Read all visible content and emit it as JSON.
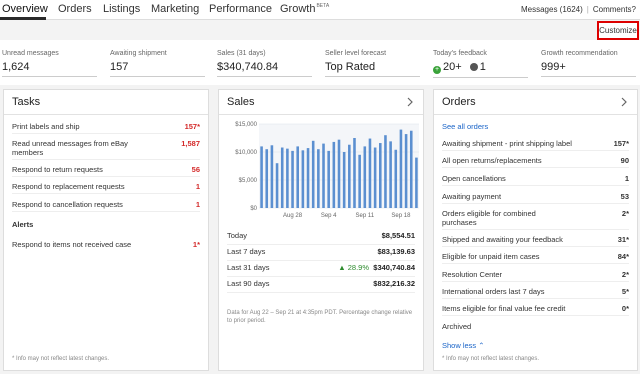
{
  "nav": {
    "tabs": [
      {
        "label": "Overview"
      },
      {
        "label": "Orders"
      },
      {
        "label": "Listings"
      },
      {
        "label": "Marketing"
      },
      {
        "label": "Performance"
      },
      {
        "label": "Growth",
        "badge": "BETA"
      }
    ],
    "messages": "Messages (1624)",
    "comments": "Comments?",
    "customize": "Customize"
  },
  "metrics": [
    {
      "label": "Unread messages",
      "value": "1,624"
    },
    {
      "label": "Awaiting shipment",
      "value": "157"
    },
    {
      "label": "Sales (31 days)",
      "value": "$340,740.84"
    },
    {
      "label": "Seller level forecast",
      "value": "Top Rated"
    },
    {
      "label": "Today's feedback",
      "positive": "20+",
      "neutral": "1"
    },
    {
      "label": "Growth recommendation",
      "value": "999+"
    }
  ],
  "tasks": {
    "title": "Tasks",
    "items": [
      {
        "label": "Print labels and ship",
        "value": "157*"
      },
      {
        "label": "Read unread messages from eBay members",
        "value": "1,587"
      },
      {
        "label": "Respond to return requests",
        "value": "56"
      },
      {
        "label": "Respond to replacement requests",
        "value": "1"
      },
      {
        "label": "Respond to cancellation requests",
        "value": "1"
      }
    ],
    "alerts_heading": "Alerts",
    "alerts": [
      {
        "label": "Respond to items not received case",
        "value": "1*"
      }
    ],
    "footnote": "* Info may not reflect latest changes."
  },
  "sales": {
    "title": "Sales",
    "rows": [
      {
        "label": "Today",
        "value": "$8,554.51"
      },
      {
        "label": "Last 7 days",
        "value": "$83,139.63"
      },
      {
        "label": "Last 31 days",
        "change": "▲ 28.9%",
        "value": "$340,740.84"
      },
      {
        "label": "Last 90 days",
        "value": "$832,216.32"
      }
    ],
    "note": "Data for Aug 22 – Sep 21 at 4:35pm PDT. Percentage change relative to prior period."
  },
  "chart_data": {
    "type": "bar",
    "categories": [
      "Aug 22",
      "Aug 23",
      "Aug 24",
      "Aug 25",
      "Aug 26",
      "Aug 27",
      "Aug 28",
      "Aug 29",
      "Aug 30",
      "Aug 31",
      "Sep 1",
      "Sep 2",
      "Sep 3",
      "Sep 4",
      "Sep 5",
      "Sep 6",
      "Sep 7",
      "Sep 8",
      "Sep 9",
      "Sep 10",
      "Sep 11",
      "Sep 12",
      "Sep 13",
      "Sep 14",
      "Sep 15",
      "Sep 16",
      "Sep 17",
      "Sep 18",
      "Sep 19",
      "Sep 20",
      "Sep 21"
    ],
    "values": [
      11000,
      10500,
      11200,
      8000,
      10800,
      10600,
      10200,
      11000,
      10300,
      10700,
      12000,
      10500,
      11500,
      10200,
      11800,
      12200,
      10000,
      11300,
      12500,
      9500,
      11000,
      12400,
      10800,
      11600,
      13000,
      11900,
      10400,
      14000,
      13200,
      13800,
      9000
    ],
    "ylim": [
      0,
      15000
    ],
    "yticks": [
      "$15,000",
      "$10,000",
      "$5,000",
      "$0"
    ],
    "xticks": [
      "Aug 28",
      "Sep 4",
      "Sep 11",
      "Sep 18"
    ],
    "color": "#5b8fd0"
  },
  "orders": {
    "title": "Orders",
    "see_all": "See all orders",
    "items": [
      {
        "label": "Awaiting shipment - print shipping label",
        "value": "157*"
      },
      {
        "label": "All open returns/replacements",
        "value": "90"
      },
      {
        "label": "Open cancellations",
        "value": "1"
      },
      {
        "label": "Awaiting payment",
        "value": "53"
      },
      {
        "label": "Orders eligible for combined purchases",
        "value": "2*"
      },
      {
        "label": "Shipped and awaiting your feedback",
        "value": "31*"
      },
      {
        "label": "Eligible for unpaid item cases",
        "value": "84*"
      },
      {
        "label": "Resolution Center",
        "value": "2*"
      },
      {
        "label": "International orders last 7 days",
        "value": "5*"
      },
      {
        "label": "Items eligible for final value fee credit",
        "value": "0*"
      },
      {
        "label": "Archived",
        "value": ""
      }
    ],
    "show_less": "Show less",
    "footnote": "* Info may not reflect latest changes."
  }
}
